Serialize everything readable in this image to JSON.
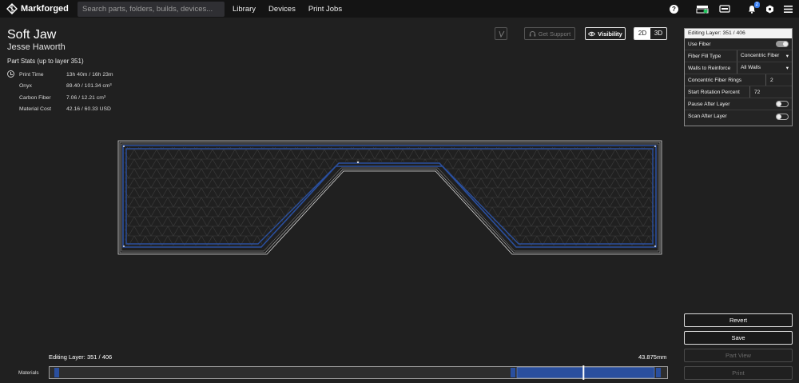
{
  "app": {
    "brand": "Markforged"
  },
  "search": {
    "placeholder": "Search parts, folders, builds, devices..."
  },
  "nav": [
    "Library",
    "Devices",
    "Print Jobs"
  ],
  "notifications": {
    "count": "2"
  },
  "part": {
    "title": "Soft Jaw",
    "author": "Jesse Haworth",
    "stats_title": "Part Stats (up to layer 351)",
    "stats": [
      {
        "label": "Print Time",
        "value": "13h 40m / 16h 23m",
        "icon": "clock-icon"
      },
      {
        "label": "Onyx",
        "value": "89.40 / 101.34 cm³"
      },
      {
        "label": "Carbon Fiber",
        "value": "7.06 / 12.21 cm³"
      },
      {
        "label": "Material Cost",
        "value": "42.16 / 60.33 USD"
      }
    ]
  },
  "toolbar": {
    "get_support": "Get Support",
    "visibility": "Visibility",
    "view_2d": "2D",
    "view_3d": "3D"
  },
  "panel": {
    "header": "Editing Layer: 351 / 406",
    "use_fiber": {
      "label": "Use Fiber",
      "on": true
    },
    "fiber_fill_type": {
      "label": "Fiber Fill Type",
      "value": "Concentric Fiber"
    },
    "walls_to_reinforce": {
      "label": "Walls to Reinforce",
      "value": "All Walls"
    },
    "concentric_rings": {
      "label": "Concentric Fiber Rings",
      "value": "2"
    },
    "start_rotation": {
      "label": "Start Rotation Percent",
      "value": "72"
    },
    "pause_after_layer": {
      "label": "Pause After Layer",
      "on": false
    },
    "scan_after_layer": {
      "label": "Scan After Layer",
      "on": false
    }
  },
  "bottom": {
    "editing_layer": "Editing Layer: 351 / 406",
    "height": "43.875mm",
    "materials_label": "Materials",
    "current_layer": 351,
    "total_layers": 406
  },
  "actions": {
    "revert": "Revert",
    "save": "Save",
    "part_view": "Part View",
    "print": "Print"
  },
  "colors": {
    "accent": "#3b82f6",
    "fiber": "#2a4f9e",
    "background": "#202020"
  }
}
